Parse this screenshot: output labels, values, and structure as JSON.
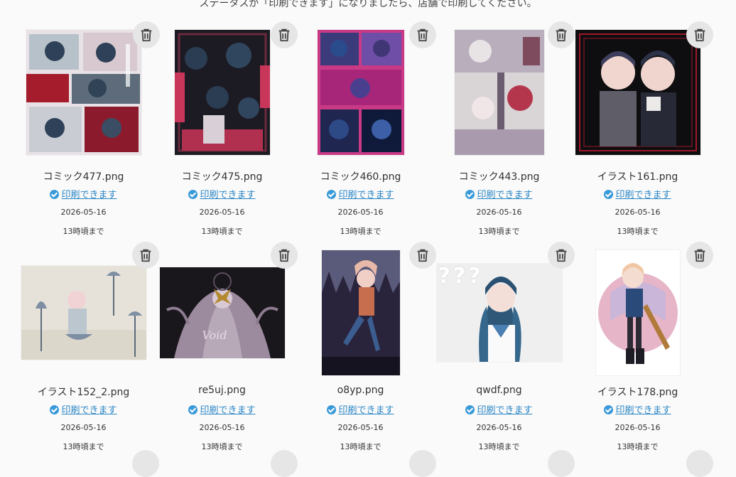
{
  "notice": "ステータスが「印刷できます」になりましたら、店舗で印刷してください。",
  "colors": {
    "link": "#2b86c5",
    "check": "#3a9ad9",
    "trash_bg": "#e6e6e6"
  },
  "icons": {
    "delete": "trash-icon",
    "status": "check-circle-icon"
  },
  "items": [
    {
      "filename": "コミック477.png",
      "status": "印刷できます",
      "date": "2026-05-16",
      "until": "13時頃まで"
    },
    {
      "filename": "コミック475.png",
      "status": "印刷できます",
      "date": "2026-05-16",
      "until": "13時頃まで"
    },
    {
      "filename": "コミック460.png",
      "status": "印刷できます",
      "date": "2026-05-16",
      "until": "13時頃まで"
    },
    {
      "filename": "コミック443.png",
      "status": "印刷できます",
      "date": "2026-05-16",
      "until": "13時頃まで"
    },
    {
      "filename": "イラスト161.png",
      "status": "印刷できます",
      "date": "2026-05-16",
      "until": "13時頃まで"
    },
    {
      "filename": "イラスト152_2.png",
      "status": "印刷できます",
      "date": "2026-05-16",
      "until": "13時頃まで"
    },
    {
      "filename": "re5uj.png",
      "status": "印刷できます",
      "date": "2026-05-16",
      "until": "13時頃まで"
    },
    {
      "filename": "o8yp.png",
      "status": "印刷できます",
      "date": "2026-05-16",
      "until": "13時頃まで"
    },
    {
      "filename": "qwdf.png",
      "status": "印刷できます",
      "date": "2026-05-16",
      "until": "13時頃まで"
    },
    {
      "filename": "イラスト178.png",
      "status": "印刷できます",
      "date": "2026-05-16",
      "until": "13時頃まで"
    }
  ],
  "thumbnail_text": {
    "void": "Void",
    "question": "???"
  }
}
